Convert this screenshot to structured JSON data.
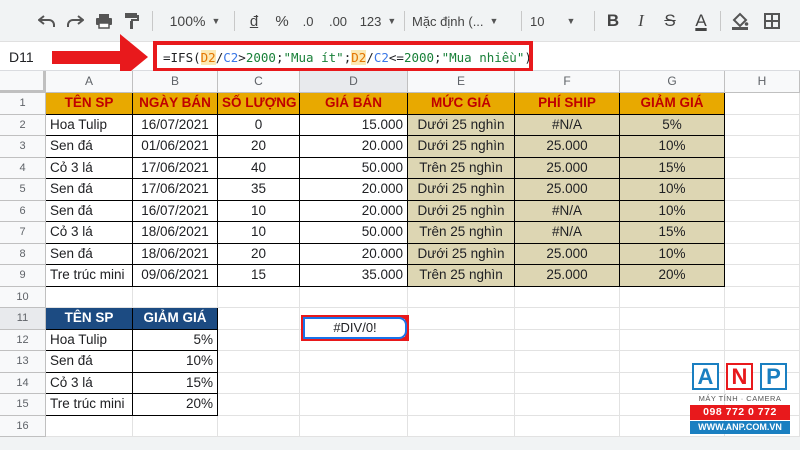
{
  "toolbar": {
    "zoom": "100%",
    "currency": "đ",
    "percent": "%",
    "dec_decrease": ".0",
    "dec_increase": ".00",
    "more_formats": "123",
    "font": "Mặc định (...",
    "font_size": "10",
    "bold": "B",
    "italic": "I",
    "strike": "S",
    "text_color": "A"
  },
  "formula_bar": {
    "cell_ref": "D11",
    "formula_parts": [
      "=IFS(",
      "D2",
      "/",
      "C2",
      ">",
      "2000",
      ";",
      "\"Mua ít\"",
      ";",
      "D2",
      "/",
      "C2",
      "<=",
      "2000",
      ";",
      "\"Mua nhiều\"",
      ")"
    ]
  },
  "columns": [
    "A",
    "B",
    "C",
    "D",
    "E",
    "F",
    "G",
    "H"
  ],
  "rows": [
    "1",
    "2",
    "3",
    "4",
    "5",
    "6",
    "7",
    "8",
    "9",
    "10",
    "11",
    "12",
    "13",
    "14",
    "15",
    "16"
  ],
  "table1": {
    "headers": [
      "TÊN SP",
      "NGÀY BÁN",
      "SỐ LƯỢNG",
      "GIÁ BÁN",
      "MỨC GIÁ",
      "PHÍ SHIP",
      "GIẢM GIÁ"
    ],
    "rows": [
      [
        "Hoa Tulip",
        "16/07/2021",
        "0",
        "15.000",
        "Dưới 25 nghìn",
        "#N/A",
        "5%"
      ],
      [
        "Sen đá",
        "01/06/2021",
        "20",
        "20.000",
        "Dưới 25 nghìn",
        "25.000",
        "10%"
      ],
      [
        "Cỏ 3 lá",
        "17/06/2021",
        "40",
        "50.000",
        "Trên 25 nghìn",
        "25.000",
        "15%"
      ],
      [
        "Sen đá",
        "17/06/2021",
        "35",
        "20.000",
        "Dưới 25 nghìn",
        "25.000",
        "10%"
      ],
      [
        "Sen đá",
        "16/07/2021",
        "10",
        "20.000",
        "Dưới 25 nghìn",
        "#N/A",
        "10%"
      ],
      [
        "Cỏ 3 lá",
        "18/06/2021",
        "10",
        "50.000",
        "Trên 25 nghìn",
        "#N/A",
        "15%"
      ],
      [
        "Sen đá",
        "18/06/2021",
        "20",
        "20.000",
        "Dưới 25 nghìn",
        "25.000",
        "10%"
      ],
      [
        "Tre trúc mini",
        "09/06/2021",
        "15",
        "35.000",
        "Trên 25 nghìn",
        "25.000",
        "20%"
      ]
    ]
  },
  "table2": {
    "headers": [
      "TÊN SP",
      "GIẢM GIÁ"
    ],
    "rows": [
      [
        "Hoa Tulip",
        "5%"
      ],
      [
        "Sen đá",
        "10%"
      ],
      [
        "Cỏ 3 lá",
        "15%"
      ],
      [
        "Tre trúc mini",
        "20%"
      ]
    ]
  },
  "d11_value": "#DIV/0!",
  "logo": {
    "letters": [
      "A",
      "N",
      "P"
    ],
    "tagline": "MÁY TÍNH · CAMERA",
    "phone": "098 772 0 772",
    "website": "WWW.ANP.COM.VN"
  },
  "colors": {
    "header_fill": "#e8a900",
    "header_text": "#c00000",
    "tan_fill": "#ddd6b3",
    "table2_header": "#1c4b82",
    "highlight_red": "#e8191c"
  }
}
